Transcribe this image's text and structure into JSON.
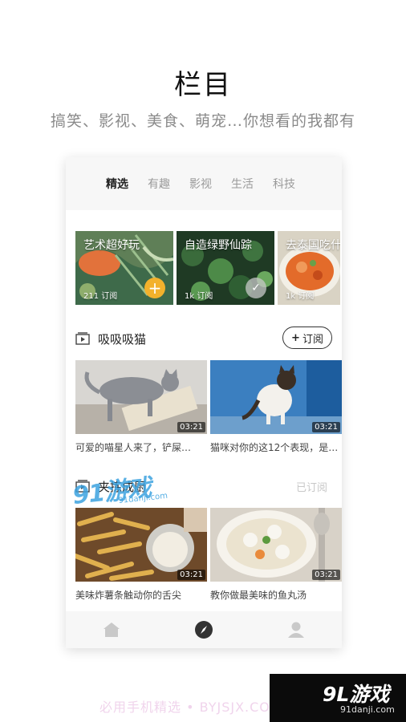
{
  "hero": {
    "title": "栏目",
    "subtitle": "搞笑、影视、美食、萌宠…你想看的我都有"
  },
  "tabs": [
    {
      "label": "精选",
      "active": true
    },
    {
      "label": "有趣",
      "active": false
    },
    {
      "label": "影视",
      "active": false
    },
    {
      "label": "生活",
      "active": false
    },
    {
      "label": "科技",
      "active": false
    }
  ],
  "channels": [
    {
      "title": "艺术超好玩",
      "count": "211 订阅",
      "state": "add"
    },
    {
      "title": "自造绿野仙踪",
      "count": "1k 订阅",
      "state": "subscribed"
    },
    {
      "title": "去泰国吃什",
      "count": "1k 订阅",
      "state": "none"
    }
  ],
  "sections": [
    {
      "title": "吸吸吸猫",
      "action_icon": "+",
      "action_label": "订阅",
      "videos": [
        {
          "caption": "可爱的喵星人来了，铲屎…",
          "duration": "03:21"
        },
        {
          "caption": "猫咪对你的这12个表现，是…",
          "duration": "03:21"
        }
      ]
    },
    {
      "title": "夹拣成厨",
      "action_label": "已订阅",
      "videos": [
        {
          "caption": "美味炸薯条触动你的舌尖",
          "duration": "03:21"
        },
        {
          "caption": "教你做最美味的鱼丸汤",
          "duration": "03:21"
        }
      ]
    }
  ],
  "watermark": {
    "logo": "91游戏",
    "url": "91danji.com"
  },
  "footer": {
    "text": "必用手机精选 • BYJSJX.COM",
    "badge_logo": "9L游戏",
    "badge_url": "91danji.com"
  },
  "colors": {
    "accent_yellow": "#f3b12c",
    "watermark_blue": "#3da3e0"
  },
  "icons": [
    "home-icon",
    "compass-icon",
    "profile-icon",
    "video-section-icon",
    "plus-icon",
    "check-icon"
  ]
}
